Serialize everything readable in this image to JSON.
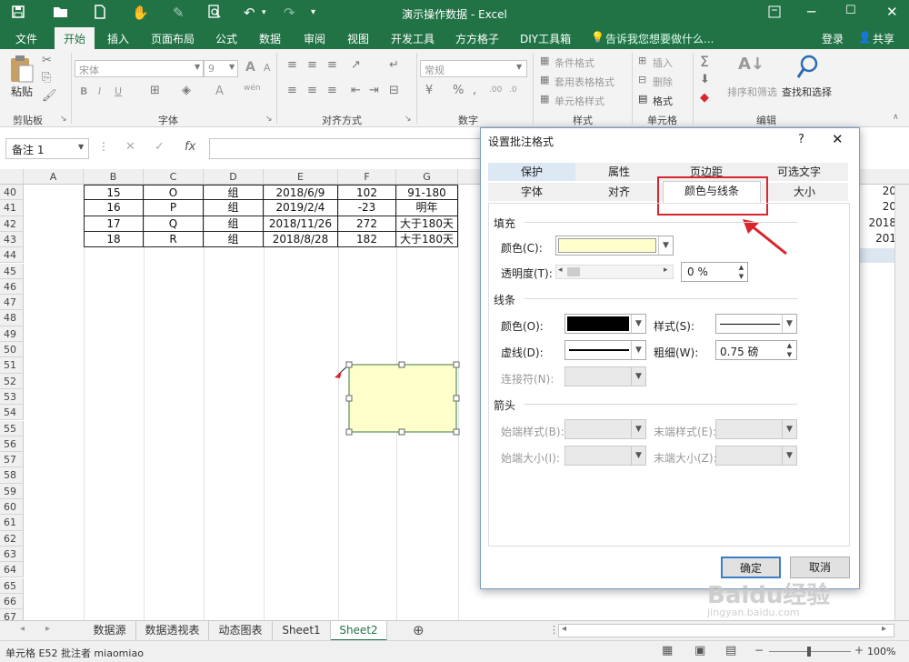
{
  "window": {
    "title": "演示操作数据 - Excel"
  },
  "ribbon_tabs": [
    "文件",
    "开始",
    "插入",
    "页面布局",
    "公式",
    "数据",
    "审阅",
    "视图",
    "开发工具",
    "方方格子",
    "DIY工具箱"
  ],
  "active_tab": "开始",
  "tell_me": "告诉我您想要做什么...",
  "account": {
    "login": "登录",
    "share": "共享"
  },
  "ribbon": {
    "paste": "粘贴",
    "clipboard": "剪贴板",
    "font_name": "宋体",
    "font_size": "9",
    "font_group": "字体",
    "align_group": "对齐方式",
    "number_format": "常规",
    "number_group": "数字",
    "styles": {
      "cond": "条件格式",
      "table": "套用表格格式",
      "cell": "单元格样式",
      "group": "样式"
    },
    "cells": {
      "insert": "插入",
      "delete": "删除",
      "format": "格式",
      "group": "单元格"
    },
    "editing": {
      "sort": "排序和筛选",
      "find": "查找和选择",
      "group": "编辑"
    }
  },
  "name_box": "备注 1",
  "fx": "fx",
  "columns": [
    "A",
    "B",
    "C",
    "D",
    "E",
    "F",
    "G"
  ],
  "rows": [
    {
      "n": "40",
      "b": "15",
      "c": "O",
      "d": "组",
      "e": "2018/6/9",
      "f": "102",
      "g": "91-180",
      "r": "20"
    },
    {
      "n": "41",
      "b": "16",
      "c": "P",
      "d": "组",
      "e": "2019/2/4",
      "f": "-23",
      "g": "明年",
      "r": "20"
    },
    {
      "n": "42",
      "b": "17",
      "c": "Q",
      "d": "组",
      "e": "2018/11/26",
      "f": "272",
      "g": "大于180天",
      "r": "2018"
    },
    {
      "n": "43",
      "b": "18",
      "c": "R",
      "d": "组",
      "e": "2018/8/28",
      "f": "182",
      "g": "大于180天",
      "r": "201"
    }
  ],
  "empty_rows": [
    "44",
    "45",
    "46",
    "47",
    "48",
    "49",
    "50",
    "51",
    "52",
    "53",
    "54",
    "55",
    "56",
    "57",
    "58",
    "59",
    "60",
    "61",
    "62",
    "63",
    "64",
    "65",
    "66",
    "67"
  ],
  "sheets": [
    "数据源",
    "数据透视表",
    "动态图表",
    "Sheet1",
    "Sheet2"
  ],
  "active_sheet": "Sheet2",
  "status": {
    "text": "单元格 E52 批注者 miaomiao",
    "zoom": "100%"
  },
  "dialog": {
    "title": "设置批注格式",
    "help": "?",
    "tabs_top": [
      "保护",
      "属性",
      "页边距",
      "可选文字"
    ],
    "tabs_bottom": [
      "字体",
      "对齐",
      "颜色与线条",
      "大小"
    ],
    "active_tab": "颜色与线条",
    "fill": {
      "section": "填充",
      "color_label": "颜色(C):",
      "color_value": "#ffffcc",
      "transparency_label": "透明度(T):",
      "transparency_value": "0 %"
    },
    "line": {
      "section": "线条",
      "color_label": "颜色(O):",
      "color_value": "#000000",
      "style_label": "样式(S):",
      "dash_label": "虚线(D):",
      "weight_label": "粗细(W):",
      "weight_value": "0.75 磅",
      "connector_label": "连接符(N):"
    },
    "arrows": {
      "section": "箭头",
      "begin_style": "始端样式(B):",
      "end_style": "末端样式(E):",
      "begin_size": "始端大小(I):",
      "end_size": "末端大小(Z):"
    },
    "ok": "确定",
    "cancel": "取消"
  },
  "colors": {
    "excel_green": "#217346",
    "highlight_red": "#d9262c",
    "comment_fill": "#ffffcc"
  },
  "watermark": "Baidu经验 jingyan.baidu.com"
}
